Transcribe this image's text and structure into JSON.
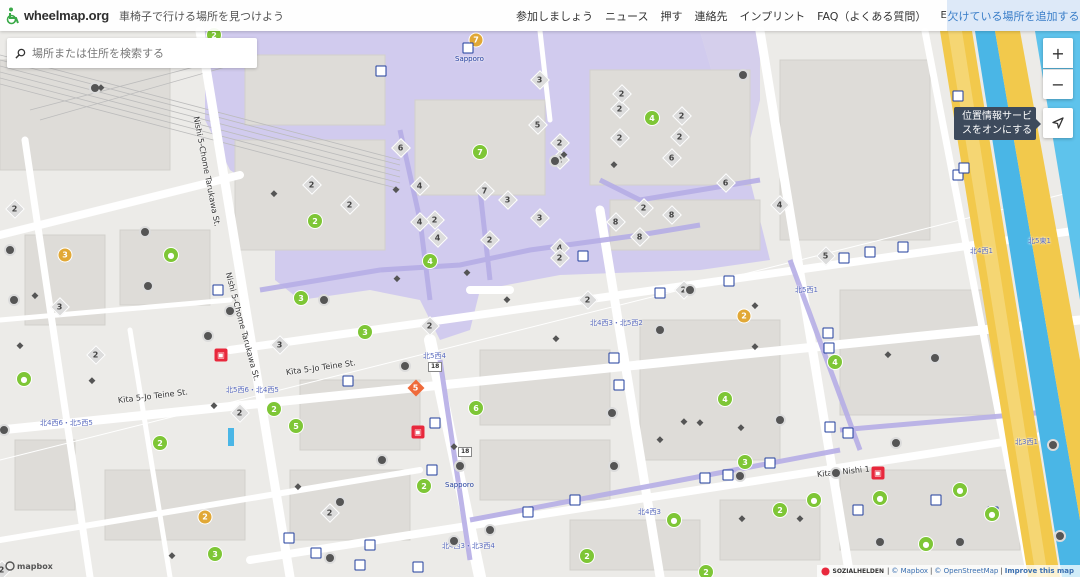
{
  "header": {
    "logo_text": "wheelmap.org",
    "tagline": "車椅子で行ける場所を見つけよう",
    "nav": [
      {
        "label": "参加しましょう"
      },
      {
        "label": "ニュース"
      },
      {
        "label": "押す"
      },
      {
        "label": "連絡先"
      },
      {
        "label": "インプリント"
      },
      {
        "label": "FAQ（よくある質問）"
      },
      {
        "label": "Events"
      }
    ],
    "add_missing": "欠けている場所を追加する"
  },
  "search": {
    "placeholder": "場所または住所を検索する"
  },
  "controls": {
    "zoom_in": "+",
    "zoom_out": "−",
    "locate_tooltip": "位置情報サービスをオンにする"
  },
  "attribution": {
    "sozialhelden": "SOZIALHELDEN",
    "mapbox": "© Mapbox",
    "osm": "© OpenStreetMap",
    "improve": "Improve this map"
  },
  "mapbox_logo": "mapbox",
  "map": {
    "streets": [
      {
        "id": "nishi5a",
        "text": "Nishi 5-Chome Tarukawa St."
      },
      {
        "id": "nishi5b",
        "text": "Nishi 5-Chome Tarukawa St."
      },
      {
        "id": "kita5teine",
        "text": "Kita 5-Jo Teine St."
      },
      {
        "id": "kita5teine2",
        "text": "Kita 5-Jo Teine St."
      },
      {
        "id": "kita3nishi1",
        "text": "Kita 3 Nishi 1"
      }
    ],
    "stations": [
      {
        "id": "sapporo1",
        "text": "Sapporo"
      },
      {
        "id": "sapporo2",
        "text": "Sapporo"
      }
    ],
    "poi_labels": [
      {
        "id": "l1",
        "text": "北4西3・北5西2"
      },
      {
        "id": "l2",
        "text": "北5西4"
      },
      {
        "id": "l3",
        "text": "北5西6・北4西5"
      },
      {
        "id": "l4",
        "text": "北4西6・北5西5"
      },
      {
        "id": "l5",
        "text": "北5西1"
      },
      {
        "id": "l6",
        "text": "北4西1"
      },
      {
        "id": "l7",
        "text": "北5東1"
      },
      {
        "id": "l8",
        "text": "北3西1"
      },
      {
        "id": "l9",
        "text": "北4西3"
      },
      {
        "id": "l10",
        "text": "北4西3・北3西4"
      }
    ],
    "route_numbers": [
      "18",
      "18"
    ],
    "pins": [
      {
        "t": "green",
        "v": "2"
      },
      {
        "t": "green",
        "v": "4"
      },
      {
        "t": "green",
        "v": "7"
      },
      {
        "t": "green",
        "v": "2"
      },
      {
        "t": "green",
        "v": "4"
      },
      {
        "t": "green",
        "v": "3"
      },
      {
        "t": "green",
        "v": "3"
      },
      {
        "t": "green",
        "v": "6"
      },
      {
        "t": "green",
        "v": "2"
      },
      {
        "t": "green",
        "v": "5"
      },
      {
        "t": "green",
        "v": "2"
      },
      {
        "t": "green",
        "v": "4"
      },
      {
        "t": "green",
        "v": "3"
      },
      {
        "t": "green",
        "v": "2"
      },
      {
        "t": "green",
        "v": "2"
      },
      {
        "t": "green",
        "v": "4"
      },
      {
        "t": "green",
        "v": "3"
      },
      {
        "t": "green",
        "v": "2"
      },
      {
        "t": "green",
        "v": "2"
      },
      {
        "t": "yellow",
        "v": "7"
      },
      {
        "t": "yellow",
        "v": "3"
      },
      {
        "t": "yellow",
        "v": "2"
      },
      {
        "t": "yellow",
        "v": "2"
      },
      {
        "t": "orange",
        "v": "5"
      }
    ],
    "grey_values": [
      "3",
      "3",
      "2",
      "5",
      "6",
      "2",
      "4",
      "2",
      "4",
      "2",
      "7",
      "8",
      "6",
      "2",
      "8",
      "2",
      "6",
      "8",
      "4",
      "4",
      "2",
      "2",
      "5",
      "3",
      "2",
      "2",
      "2",
      "3",
      "2",
      "2",
      "2",
      "2",
      "2",
      "3",
      "2",
      "2",
      "2",
      "3",
      "2",
      "4",
      "2"
    ]
  }
}
